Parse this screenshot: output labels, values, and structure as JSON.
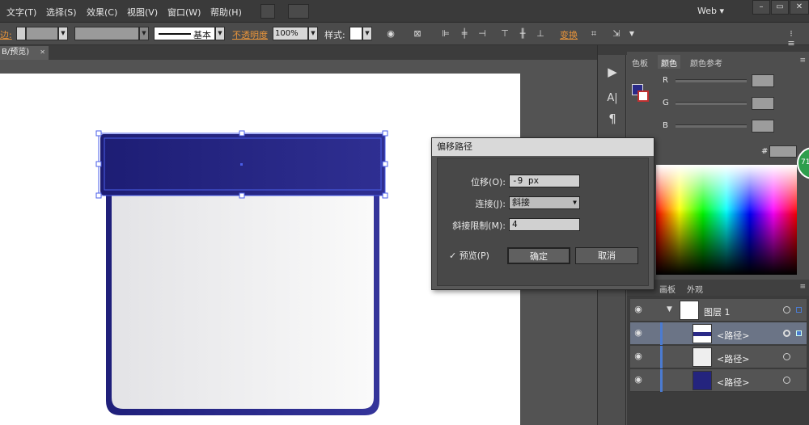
{
  "menubar": {
    "items": [
      "文字(T)",
      "选择(S)",
      "效果(C)",
      "视图(V)",
      "窗口(W)",
      "帮助(H)"
    ],
    "workspace": "Web",
    "workspace_arrow": "▾",
    "win_min": "–",
    "win_max": "▭",
    "win_close": "✕"
  },
  "controlbar": {
    "stroke_label": "边:",
    "stroke_style": "基本",
    "opacity_label": "不透明度",
    "opacity_value": "100%",
    "style_label": "样式:",
    "transform_label": "变换"
  },
  "document": {
    "tab_title": "B/预览)",
    "tab_close": "✕"
  },
  "tools": {
    "icons": [
      "play-icon",
      "type-icon",
      "paragraph-icon"
    ],
    "play": "▶",
    "type": "A|",
    "paragraph": "¶"
  },
  "color_panel": {
    "tabs": [
      "色板",
      "颜色",
      "颜色参考"
    ],
    "active_tab": "颜色",
    "channels": [
      "R",
      "G",
      "B"
    ],
    "hex_label": "#",
    "fill_color": "#2a2a88",
    "badge": "71"
  },
  "layers_panel": {
    "tabs": [
      "画板",
      "外观"
    ],
    "layer_name": "图层 1",
    "rows": [
      "<路径>",
      "<路径>",
      "<路径>"
    ]
  },
  "dialog": {
    "title": "偏移路径",
    "offset_label": "位移(O):",
    "offset_value": "-9 px",
    "join_label": "连接(J):",
    "join_value": "斜接",
    "miter_label": "斜接限制(M):",
    "miter_value": "4",
    "preview_label": "预览(P)",
    "preview_checked": true,
    "ok_label": "确定",
    "cancel_label": "取消"
  },
  "colors": {
    "art_navy_dark": "#1f1f7a",
    "art_navy_light": "#34349a",
    "selection_blue": "#4a5ee8",
    "accent_orange": "#e8943a"
  }
}
